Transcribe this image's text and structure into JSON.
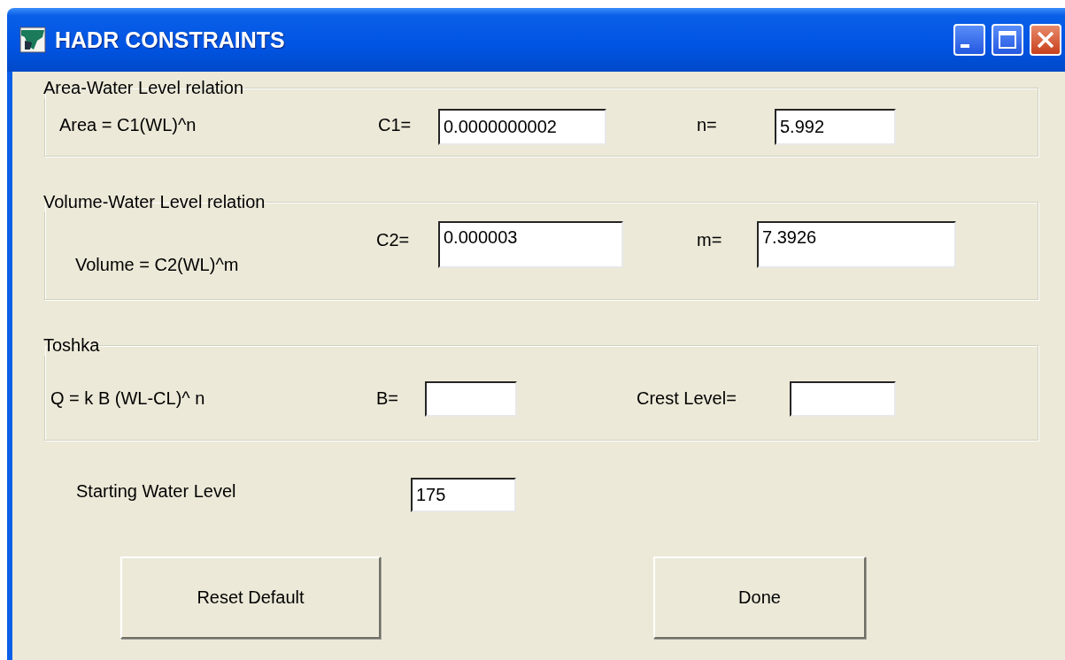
{
  "window": {
    "title": "HADR CONSTRAINTS"
  },
  "groups": [
    {
      "legend": "Area-Water Level relation",
      "formula": "Area = C1(WL)^n",
      "fields": [
        {
          "label": "C1=",
          "value": "0.0000000002"
        },
        {
          "label": "n=",
          "value": "5.992"
        }
      ]
    },
    {
      "legend": "Volume-Water Level relation",
      "formula": "Volume = C2(WL)^m",
      "fields": [
        {
          "label": "C2=",
          "value": "0.000003"
        },
        {
          "label": "m=",
          "value": "7.3926"
        }
      ]
    },
    {
      "legend": "Toshka",
      "formula": "Q = k B (WL-CL)^ n",
      "fields": [
        {
          "label": "B="
        },
        {
          "label": "Crest Level="
        }
      ]
    }
  ],
  "starting_level": {
    "label": "Starting Water Level",
    "value": "175"
  },
  "buttons": [
    "Reset Default",
    "Done"
  ]
}
